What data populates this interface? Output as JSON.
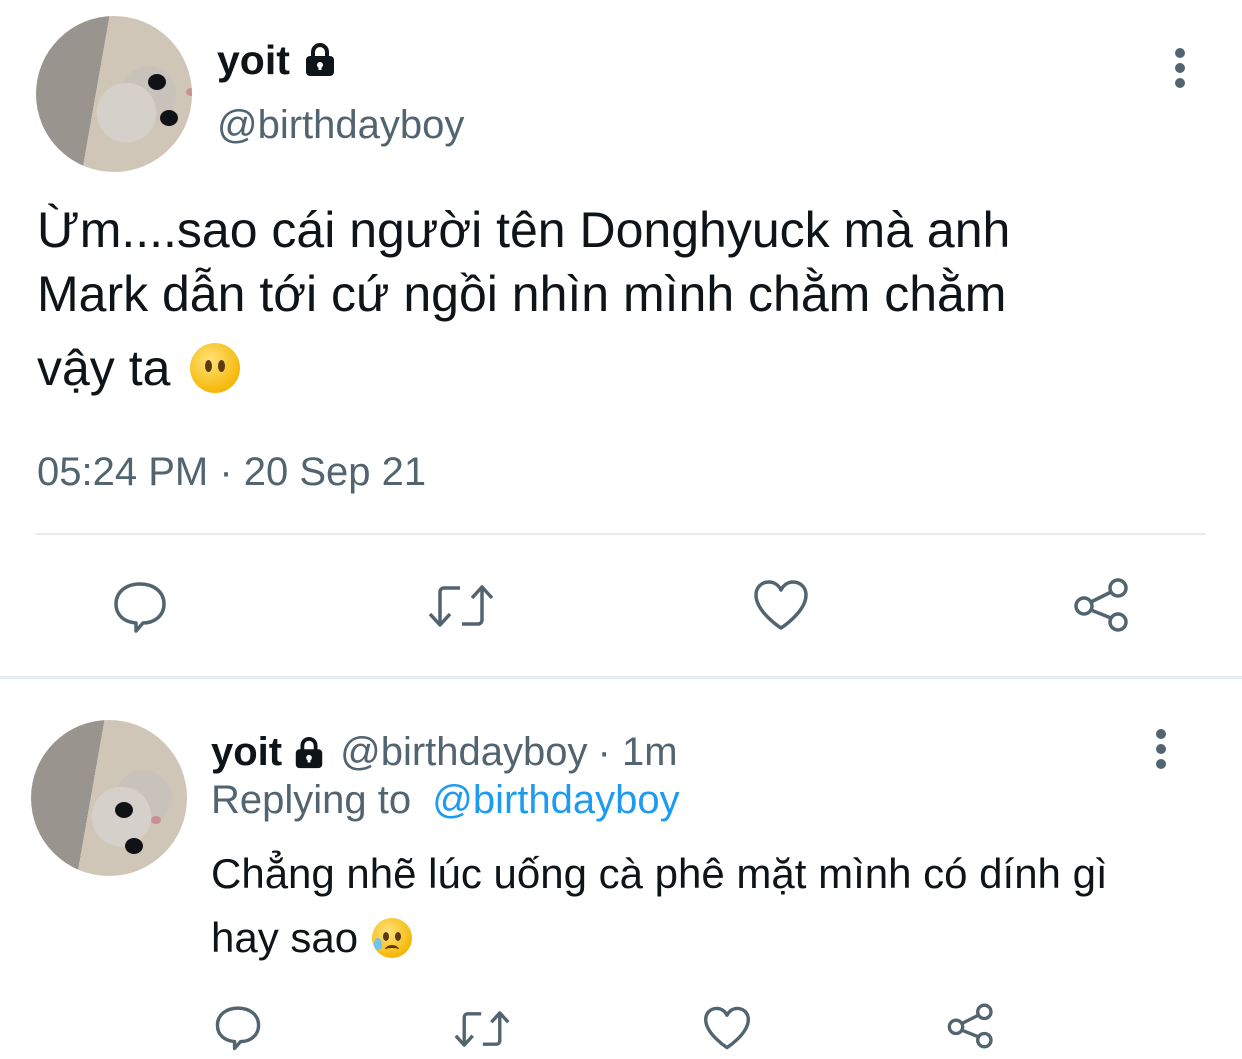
{
  "main_tweet": {
    "display_name": "yoit",
    "handle": "@birthdayboy",
    "text_line1": "Ừm....sao cái người tên Donghyuck mà anh",
    "text_line2": "Mark dẫn tới cứ ngồi nhìn mình chằm chằm",
    "text_line3": "vậy ta",
    "emoji": "flushed-face-no-mouth",
    "timestamp": "05:24 PM · 20 Sep 21",
    "actions": [
      "reply-icon",
      "retweet-icon",
      "like-icon",
      "share-icon"
    ]
  },
  "reply_tweet": {
    "display_name": "yoit",
    "handle": "@birthdayboy",
    "time": "· 1m",
    "replying_label": "Replying to",
    "replying_handle": "@birthdayboy",
    "text_line1": "Chẳng nhẽ lúc uống cà phê mặt mình có dính gì",
    "text_line2": "hay sao",
    "emoji": "sad-but-relieved-face",
    "actions": [
      "reply-icon",
      "retweet-icon",
      "like-icon",
      "share-icon"
    ]
  },
  "colors": {
    "text": "#0f1419",
    "secondary": "#536471",
    "link": "#1d9bf0",
    "divider": "#e6ecf0"
  }
}
